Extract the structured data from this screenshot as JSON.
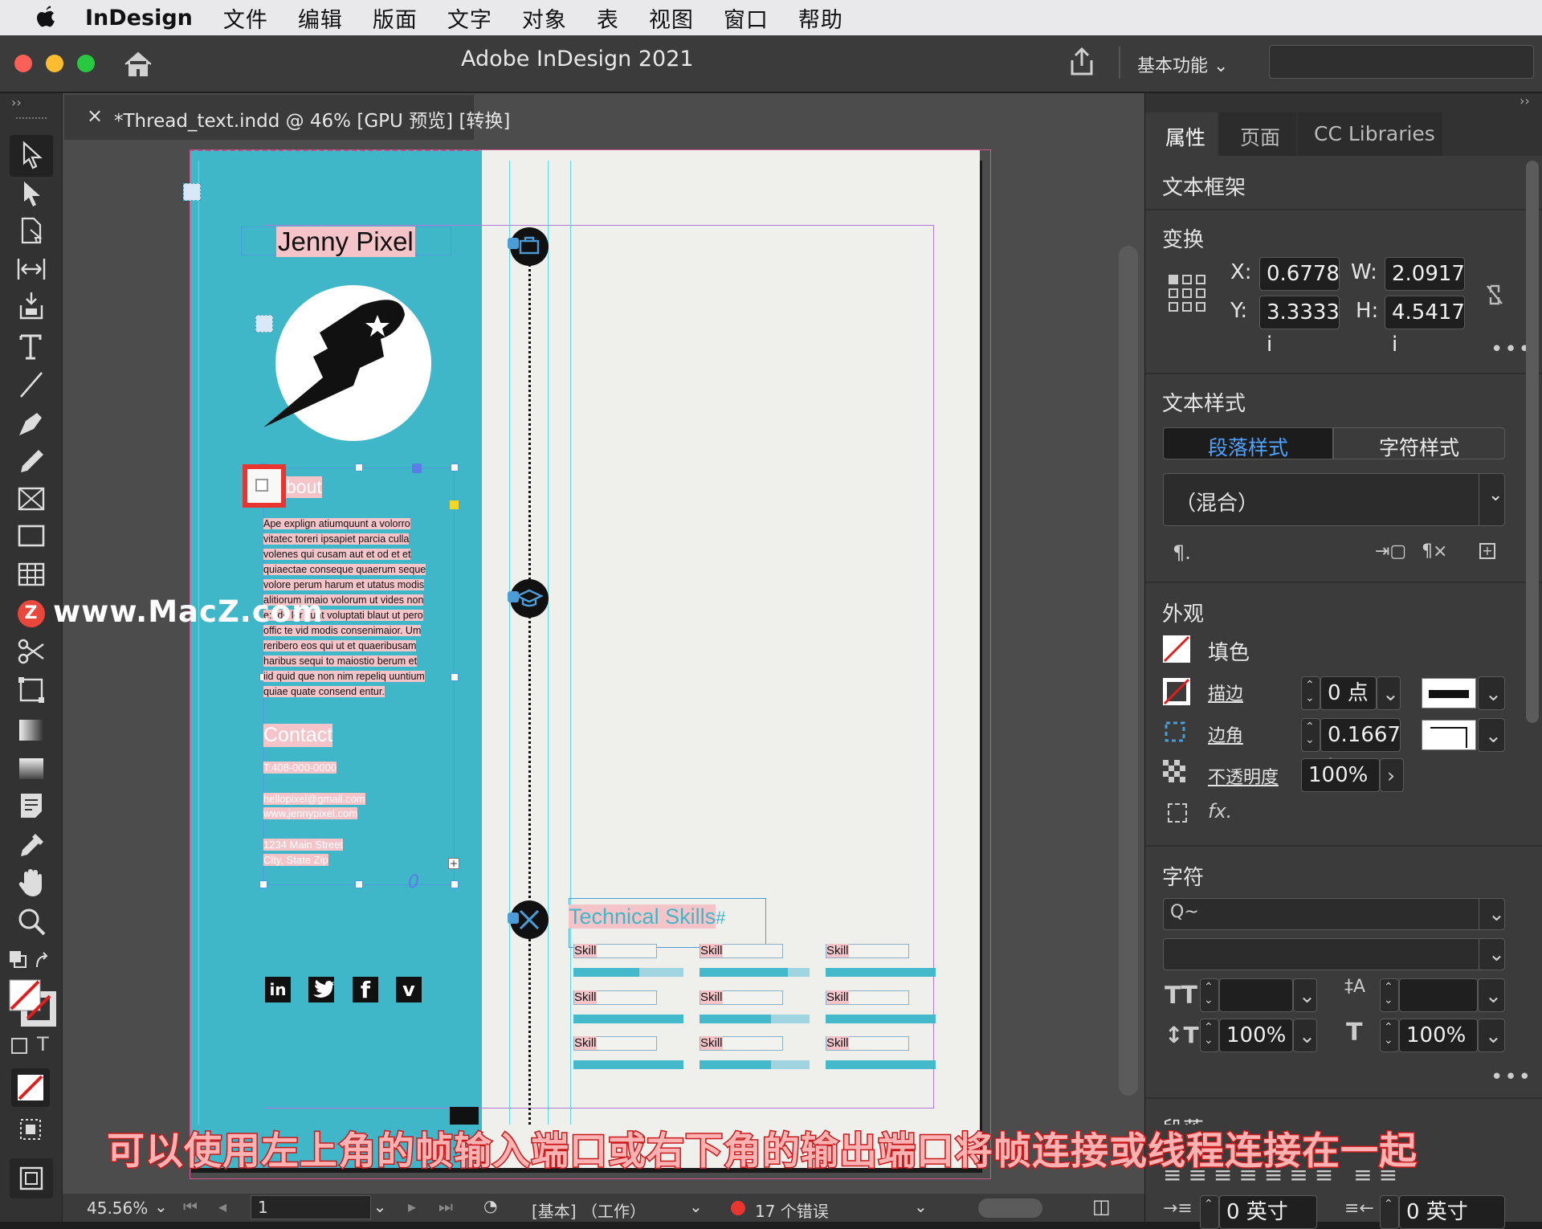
{
  "menubar": {
    "app_name": "InDesign",
    "items": [
      "文件",
      "编辑",
      "版面",
      "文字",
      "对象",
      "表",
      "视图",
      "窗口",
      "帮助"
    ]
  },
  "titlebar": {
    "title": "Adobe InDesign 2021",
    "workspace": "基本功能"
  },
  "document_tab": {
    "label": "*Thread_text.indd @ 46% [GPU 预览] [转换]"
  },
  "page": {
    "name": "Jenny Pixel",
    "about_heading": "bout",
    "about_text": [
      "Ape explign atiumquunt a volorro",
      "vitatec toreri ipsapiet parcia culla",
      "volenes qui cusam aut et od et et",
      "quiaectae conseque quaerum seque",
      "volore perum harum et utatus modis",
      "alitiorum imaio volorum ut vides non",
      "e:t de lor sunt voluptati blaut ut pero",
      "offic te vid modis consenimaior. Um",
      "reribero eos qui ut et quaeribusam",
      "haribus sequi to maiostio berum et",
      "iid quid que non nim repeliq uuntium",
      "quiae quate consend entur."
    ],
    "contact_heading": "Contact",
    "phone": "T:408-000-0000",
    "email": "hellopixel@gmail.com",
    "website": "www.jennypixel.com",
    "address1": "1234 Main Street",
    "address2": "City, State Zip",
    "social_icons": [
      "linkedin-icon",
      "twitter-icon",
      "facebook-icon",
      "vimeo-icon"
    ],
    "skills_heading": "Technical Skills",
    "skills": [
      {
        "label": "Skill",
        "level": 0.6
      },
      {
        "label": "Skill",
        "level": 0.8
      },
      {
        "label": "Skill",
        "level": 1.0
      },
      {
        "label": "Skill",
        "level": 1.0
      },
      {
        "label": "Skill",
        "level": 0.65
      },
      {
        "label": "Skill",
        "level": 1.0
      },
      {
        "label": "Skill",
        "level": 1.0
      },
      {
        "label": "Skill",
        "level": 0.65
      },
      {
        "label": "Skill",
        "level": 1.0
      }
    ],
    "colors": {
      "sidebar": "#3fb7c9",
      "page": "#efefeb"
    }
  },
  "panel": {
    "tabs": [
      "属性",
      "页面",
      "CC Libraries"
    ],
    "object_type": "文本框架",
    "transform": {
      "heading": "变换",
      "x_label": "X:",
      "x": "0.6778 i",
      "w_label": "W:",
      "w": "2.0917 i",
      "y_label": "Y:",
      "y": "3.3333 i",
      "h_label": "H:",
      "h": "4.5417 i"
    },
    "text_style": {
      "heading": "文本样式",
      "paragraph_tab": "段落样式",
      "character_tab": "字符样式",
      "style_value": "（混合）"
    },
    "appearance": {
      "heading": "外观",
      "fill_label": "填色",
      "stroke_label": "描边",
      "stroke_value": "0 点",
      "corner_label": "边角",
      "corner_value": "0.1667 i",
      "opacity_label": "不透明度",
      "opacity_value": "100%"
    },
    "character": {
      "heading": "字符",
      "search_placeholder": "Q~",
      "scale_h": "100%",
      "scale_v": "100%"
    },
    "bottom": {
      "truncated_heading": "段落",
      "indent_left": "0 英寸",
      "indent_right": "0 英寸"
    }
  },
  "statusbar": {
    "zoom": "45.56%",
    "page_number": "1",
    "preflight_profile": "[基本] （工作）",
    "errors": "17 个错误"
  },
  "watermark": "www.MacZ.com",
  "caption": "可以使用左上角的帧输入端口或右下角的输出端口将帧连接或线程连接在一起"
}
